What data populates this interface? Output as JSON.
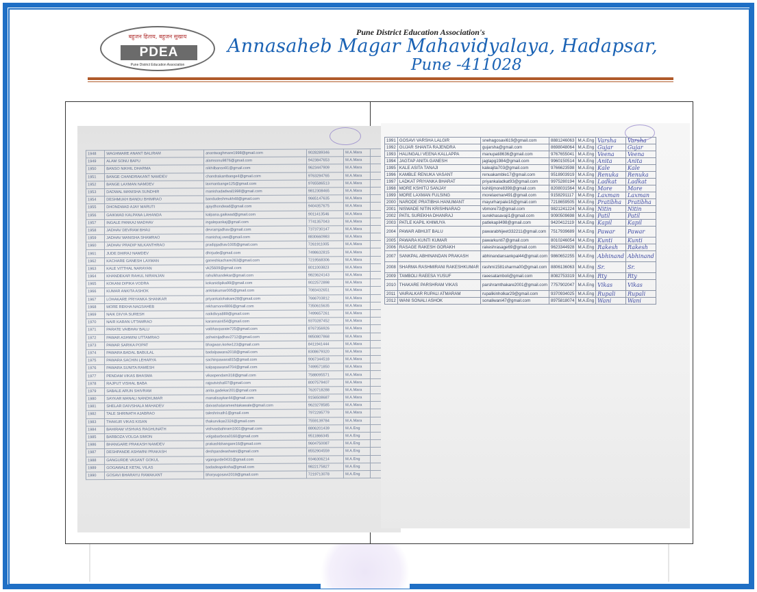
{
  "header": {
    "logo_tagline": "बहुजन हिताय, बहुजन सुखाय",
    "logo_text": "PDEA",
    "logo_subtext": "Pune District Education Association",
    "association": "Pune District Education Association's",
    "college": "Annasaheb Magar Mahavidyalaya, Hadapsar,",
    "city": "Pune -411028"
  },
  "right_sheet": {
    "rows": [
      {
        "id": "1991",
        "name": "GOSAVI VARSHA LALGIR",
        "email": "snehagosavi619@gmail.com",
        "phone": "8881246063",
        "course": "M.A.Eng",
        "sig": "Varsha",
        "sig2": "Varsha"
      },
      {
        "id": "1992",
        "name": "GUJAR SHANTA RAJENDRA",
        "email": "gujarsha@gmail.com",
        "phone": "8698048064",
        "course": "M.A.Eng",
        "sig": "Gujar",
        "sig2": "Gujar"
      },
      {
        "id": "1993",
        "name": "HALINGALI VEENA KALLAPPA",
        "email": "manupati8636@gmail.com",
        "phone": "9767655041",
        "course": "M.A.Eng",
        "sig": "Veena",
        "sig2": "Veena"
      },
      {
        "id": "1994",
        "name": "JAGTAP ANITA GANESH",
        "email": "jagtapg1984@gmail.com",
        "phone": "9960150514",
        "course": "M.A.Eng",
        "sig": "Anita",
        "sig2": "Anita"
      },
      {
        "id": "1995",
        "name": "KALE ASITA TANAJI",
        "email": "kaleajita703@gmail.com",
        "phone": "9766623598",
        "course": "M.A.Eng",
        "sig": "Kale",
        "sig2": "Kale"
      },
      {
        "id": "1996",
        "name": "KAMBLE RENUKA VASANT",
        "email": "renuakamble17@gmail.com",
        "phone": "9518903919",
        "course": "M.A.Eng",
        "sig": "Renuka",
        "sig2": "Renuka"
      },
      {
        "id": "1997",
        "name": "LADKAT PRIYANKA BHARAT",
        "email": "priyankaladkat93@gmail.com",
        "phone": "9975280194",
        "course": "M.A.Eng",
        "sig": "Ladkat",
        "sig2": "Ladkat"
      },
      {
        "id": "1998",
        "name": "MORE KSHITIJ SANJAY",
        "email": "kshitijmore8398@gmail.com",
        "phone": "8208031564",
        "course": "M.A.Eng",
        "sig": "More",
        "sig2": "More"
      },
      {
        "id": "1999",
        "name": "MORE LAXMAN FULSING",
        "email": "morelaxman491@gmail.com",
        "phone": "9158291117",
        "course": "M.A.Eng",
        "sig": "Laxman",
        "sig2": "Laxman"
      },
      {
        "id": "2000",
        "name": "NARODE PRATIBHA HANUMANT",
        "email": "mayurharpale18@gmail.com",
        "phone": "7218659505",
        "course": "M.A.Eng",
        "sig": "Pratibha",
        "sig2": "Pratibha"
      },
      {
        "id": "2001",
        "name": "NISWADE NITIN KRISHNARAO",
        "email": "vbmore73@gmail.com",
        "phone": "9821241224",
        "course": "M.A.Eng",
        "sig": "Nitin",
        "sig2": "Nitin"
      },
      {
        "id": "2002",
        "name": "PATIL SUREKHA DHANRAJ",
        "email": "surekhasavaji1@gmail.com",
        "phone": "9090509698",
        "course": "M.A.Eng",
        "sig": "Patil",
        "sig2": "Patil"
      },
      {
        "id": "2003",
        "name": "PATLE KAPIL KHIMUYA",
        "email": "patlekapil498@gmail.com",
        "phone": "9420412119",
        "course": "M.A.Eng",
        "sig": "Kapil",
        "sig2": "Kapil"
      },
      {
        "id": "2004",
        "name": "PAWAR ABHIJIT BALU",
        "email": "pawarabhijeet332211@gmail.com",
        "phone": "7517939689",
        "course": "M.A.Eng",
        "sig": "Pawar",
        "sig2": "Pawar"
      },
      {
        "id": "2005",
        "name": "PAWARA KUNTI KUMAR",
        "email": "pawarkunti7@gmail.com",
        "phone": "8010246054",
        "course": "M.A.Eng",
        "sig": "Kunti",
        "sig2": "Kunti"
      },
      {
        "id": "2006",
        "name": "RASAGE RAKESH GORAKH",
        "email": "rakeshrasage69@gmail.com",
        "phone": "9623344928",
        "course": "M.A.Eng",
        "sig": "Rakesh",
        "sig2": "Rakesh"
      },
      {
        "id": "2007",
        "name": "SANKPAL ABHINANDAN PRAKASH",
        "email": "abhinandansankpal44@gmail.com",
        "phone": "9860652255",
        "course": "M.A.Eng",
        "sig": "Abhinand",
        "sig2": "Abhinand"
      },
      {
        "id": "2008",
        "name": "SHARMA RASHMIRANI RAKESHKUMAR",
        "email": "rashmi1581sharma00@gmail.com",
        "phone": "8806136063",
        "course": "M.A.Eng",
        "sig": "Sr.",
        "sig2": "Sr."
      },
      {
        "id": "2009",
        "name": "TAMBOLI RAEESA YUSUF",
        "email": "raeesatamboli@gmail.com",
        "phone": "8082753319",
        "course": "M.A.Eng",
        "sig": "Rty",
        "sig2": "Rty"
      },
      {
        "id": "2010",
        "name": "THAKARE PARSHRAM VIKAS",
        "email": "parshramthakare2001@gmail.com",
        "phone": "7757902047",
        "course": "M.A.Eng",
        "sig": "Vikas",
        "sig2": "Vikas"
      },
      {
        "id": "2011",
        "name": "VAIRALKAR RUPALI ATMARAM",
        "email": "rupalikinholkar29@gmail.com",
        "phone": "9370934025",
        "course": "M.A.Eng",
        "sig": "Rupali",
        "sig2": "Rupali"
      },
      {
        "id": "2012",
        "name": "WANI SONALI ASHOK",
        "email": "sonaliwani47@gmail.com",
        "phone": "8975818074",
        "course": "M.A.Eng",
        "sig": "Wani",
        "sig2": "Wani"
      }
    ]
  },
  "left_sheet": {
    "rows": [
      {
        "id": "1948",
        "name": "WAGHMARE ANANT BALIRAM",
        "email": "anantwaghmare1998@gmail.com",
        "phone": "9028289346",
        "course": "M.A.Mara"
      },
      {
        "id": "1949",
        "name": "ALAM SONU BAPU",
        "email": "alamsonu9876@gmail.com",
        "phone": "9423847653",
        "course": "M.A.Mara"
      },
      {
        "id": "1950",
        "name": "BANSO NIKHIL DHARMA",
        "email": "nikhilbanso91@gmail.com",
        "phone": "9623447909",
        "course": "M.A.Mara"
      },
      {
        "id": "1951",
        "name": "BANGE CHANDRAKANT NAMDEV",
        "email": "chandrakantbange4@gmail.com",
        "phone": "9763294765",
        "course": "M.A.Mara"
      },
      {
        "id": "1952",
        "name": "BANGE LAXMAN NAMDEV",
        "email": "laxmanbange125@gmail.com",
        "phone": "9765586513",
        "course": "M.A.Mara"
      },
      {
        "id": "1953",
        "name": "DADWAL MANISHA SUNDHIR",
        "email": "manishadadwal1998@gmail.com",
        "phone": "9812308465",
        "course": "M.A.Mara"
      },
      {
        "id": "1954",
        "name": "DESHMUKH BANDU BHIMRAO",
        "email": "bandudeshmukh48@gmail.com",
        "phone": "9665147635",
        "course": "M.A.Mara"
      },
      {
        "id": "1955",
        "name": "DHONDWAD AJAY MARUTI",
        "email": "ajaydhondwad@gmail.com",
        "phone": "9404357675",
        "course": "M.A.Mara"
      },
      {
        "id": "1956",
        "name": "GAIKWAD KALPANA LAHANDA",
        "email": "kalpana.gaikwad@gmail.com",
        "phone": "9011413546",
        "course": "M.A.Mara"
      },
      {
        "id": "1957",
        "name": "INGALE PANKAJ MADHAV",
        "email": "ingalepankaj@gmail.com",
        "phone": "7741357043",
        "course": "M.A.Mara"
      },
      {
        "id": "1958",
        "name": "JADHAV DEVRAM BHAU",
        "email": "devramjadhav@gmail.com",
        "phone": "7373730147",
        "course": "M.A.Mara"
      },
      {
        "id": "1959",
        "name": "JADHAV MANISHA SHAMRAO",
        "email": "manishaj.vws@gmail.com",
        "phone": "8830660983",
        "course": "M.A.Mara"
      },
      {
        "id": "1960",
        "name": "JADHAV PRADIP NILKANTHRAO",
        "email": "pradipjadhav1005@gmail.com",
        "phone": "7261911005",
        "course": "M.A.Mara"
      },
      {
        "id": "1961",
        "name": "JUDE DHIRAJ NAMDEV",
        "email": "dhirjude@gmail.com",
        "phone": "7498632815",
        "course": "M.A.Mara"
      },
      {
        "id": "1962",
        "name": "KACHARE GANESH LAXMAN",
        "email": "ganeshkachare263@gmail.com",
        "phone": "7219568306",
        "course": "M.A.Mara"
      },
      {
        "id": "1963",
        "name": "KALE VITTHAL NARAYAN",
        "email": "vk25609@gmail.com",
        "phone": "8011003823",
        "course": "M.A.Mara"
      },
      {
        "id": "1964",
        "name": "KHANDEKAR RAHUL NIRANJAN",
        "email": "rahulkhandekar@gmail.com",
        "phone": "9823624143",
        "course": "M.A.Mara"
      },
      {
        "id": "1965",
        "name": "KOKANI DIPIKA VODRA",
        "email": "kokanidipika99@gmail.com",
        "phone": "9022572898",
        "course": "M.A.Mara"
      },
      {
        "id": "1966",
        "name": "KUMAR ANKITA ASHOK",
        "email": "ankitakumar005@gmail.com",
        "phone": "7083432651",
        "course": "M.A.Mara"
      },
      {
        "id": "1967",
        "name": "LOHAKARE PRIYANKA SHANKAR",
        "email": "priyankalohakare28@gmail.com",
        "phone": "7666703812",
        "course": "M.A.Mara"
      },
      {
        "id": "1968",
        "name": "MORE REKHA NAGSAHEB",
        "email": "rekhamore4806@gmail.com",
        "phone": "7350615635",
        "course": "M.A.Mara"
      },
      {
        "id": "1969",
        "name": "NAIK DIVYA SURESH",
        "email": "naikdivya889@gmail.com",
        "phone": "7499657261",
        "course": "M.A.Mara"
      },
      {
        "id": "1970",
        "name": "NAIR KARAN UTTAMRAO",
        "email": "karannair454@gmail.com",
        "phone": "9370287452",
        "course": "M.A.Mara"
      },
      {
        "id": "1971",
        "name": "PARATE VAIBHAV BALU",
        "email": "vaibhavparate725@gmail.com",
        "phone": "8767356926",
        "course": "M.A.Mara"
      },
      {
        "id": "1972",
        "name": "PAWAR ASHWINI UTTAMRAO",
        "email": "ashwinijadhav2712@gmail.com",
        "phone": "9850807868",
        "course": "M.A.Mara"
      },
      {
        "id": "1973",
        "name": "PAWAR SARIKA POPAT",
        "email": "bhagwan.korke123@gmail.com",
        "phone": "8411941444",
        "course": "M.A.Mara"
      },
      {
        "id": "1974",
        "name": "PAWARA BADAL BABULAL",
        "email": "badalpawara2018@gmail.com",
        "phone": "8308679320",
        "course": "M.A.Mara"
      },
      {
        "id": "1975",
        "name": "PAWARA SACHIN LEHARYA",
        "email": "sachinpawara815@gmail.com",
        "phone": "9067344518",
        "course": "M.A.Mara"
      },
      {
        "id": "1976",
        "name": "PAWARA SUNITA RAMESH",
        "email": "kalpapawara4704@gmail.com",
        "phone": "7499571850",
        "course": "M.A.Mara"
      },
      {
        "id": "1977",
        "name": "PENDAM VIKAS BHASMA",
        "email": "vikaspendam318@gmail.com",
        "phone": "7588095571",
        "course": "M.A.Mara"
      },
      {
        "id": "1978",
        "name": "RAJPUT VISHAL BABA",
        "email": "rajputvishal07@gmail.com",
        "phone": "8007579407",
        "course": "M.A.Mara"
      },
      {
        "id": "1979",
        "name": "SABALE ARUN SHIVRAM",
        "email": "anita.gadekar201@gmail.com",
        "phone": "7620718288",
        "course": "M.A.Mara"
      },
      {
        "id": "1980",
        "name": "SAYKAR MANALI NANDKUMAR",
        "email": "manalisaykar44@gmail.com",
        "phone": "9156508687",
        "course": "M.A.Mara"
      },
      {
        "id": "1981",
        "name": "SHELAR DAIVSHALA MAHADEV",
        "email": "daivashalarameshtakawale@gmail.com",
        "phone": "9623278585",
        "course": "M.A.Mara"
      },
      {
        "id": "1982",
        "name": "TALE SHRINATH AJABRAO",
        "email": "taleshrinath1@gmail.com",
        "phone": "7972295779",
        "course": "M.A.Mara"
      },
      {
        "id": "1983",
        "name": "THAKUR VIKAS KISAN",
        "email": "thakurvikas2324@gmail.com",
        "phone": "7559139784",
        "course": "M.A.Mara"
      },
      {
        "id": "1984",
        "name": "BAHIRAM VISHVAS RAGHUNATH",
        "email": "vishvasbahiram1001@gmail.com",
        "phone": "8806201439",
        "course": "M.A.Eng"
      },
      {
        "id": "1985",
        "name": "BARBOZA VOLGA SIMON",
        "email": "volgabarboza0160@gmail.com",
        "phone": "9511866345",
        "course": "M.A.Eng"
      },
      {
        "id": "1986",
        "name": "BHANGARE PRAKASH NAMDEV",
        "email": "prakashbhangare16@gmail.com",
        "phone": "9604750087",
        "course": "M.A.Eng"
      },
      {
        "id": "1987",
        "name": "DESHPANDE ASHWINI PRAKASH",
        "email": "deshpandeashwini@gmail.com",
        "phone": "8552904559",
        "course": "M.A.Eng"
      },
      {
        "id": "1988",
        "name": "GANGURDE VASANT GOKUL",
        "email": "vgangurde0431@gmail.com",
        "phone": "9346306214",
        "course": "M.A.Eng"
      },
      {
        "id": "1989",
        "name": "GOGAWALE KETAL VILAS",
        "email": "badadeapoksha@gmail.com",
        "phone": "9822175827",
        "course": "M.A.Eng"
      },
      {
        "id": "1990",
        "name": "GOSAVI BHARAYU RAMAKANT",
        "email": "bharyugosavi2019@gmail.com",
        "phone": "7219713078",
        "course": "M.A.Eng"
      }
    ]
  }
}
